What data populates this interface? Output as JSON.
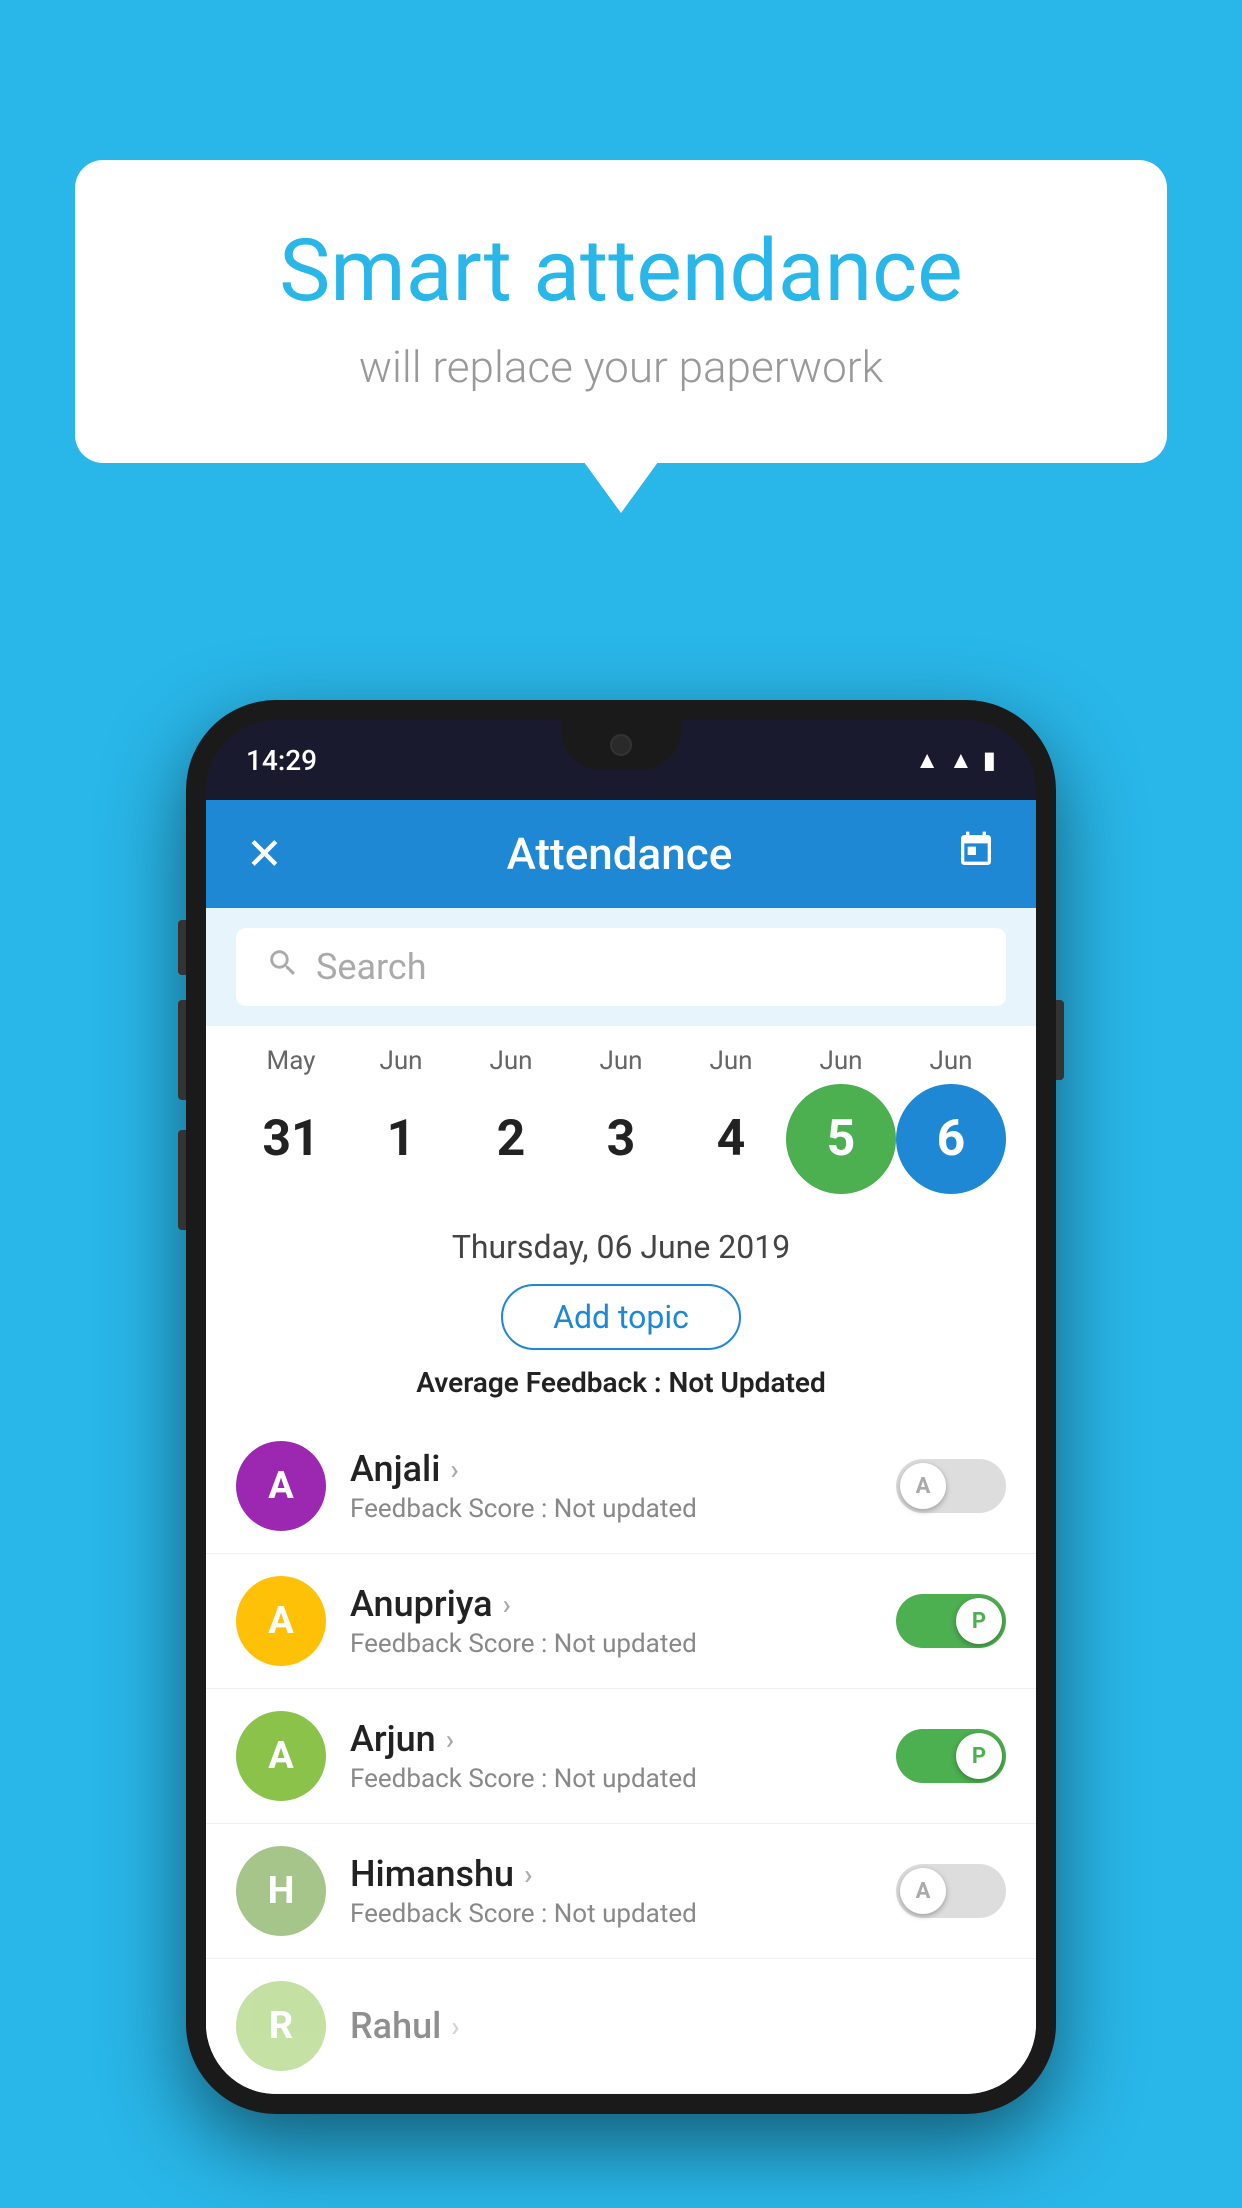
{
  "background_color": "#29b6e8",
  "speech_bubble": {
    "title": "Smart attendance",
    "subtitle": "will replace your paperwork"
  },
  "phone": {
    "status_bar": {
      "time": "14:29",
      "icons": [
        "wifi",
        "signal",
        "battery"
      ]
    },
    "header": {
      "title": "Attendance",
      "close_label": "✕",
      "calendar_icon": "📅"
    },
    "search": {
      "placeholder": "Search"
    },
    "calendar": {
      "months": [
        "May",
        "Jun",
        "Jun",
        "Jun",
        "Jun",
        "Jun",
        "Jun"
      ],
      "dates": [
        "31",
        "1",
        "2",
        "3",
        "4",
        "5",
        "6"
      ],
      "today_index": 5,
      "selected_index": 6
    },
    "date_display": "Thursday, 06 June 2019",
    "add_topic_label": "Add topic",
    "avg_feedback_label": "Average Feedback :",
    "avg_feedback_value": "Not Updated",
    "students": [
      {
        "name": "Anjali",
        "initial": "A",
        "avatar_color": "#9c27b0",
        "feedback": "Feedback Score : Not updated",
        "attendance": "A",
        "status": "off"
      },
      {
        "name": "Anupriya",
        "initial": "A",
        "avatar_color": "#ffc107",
        "feedback": "Feedback Score : Not updated",
        "attendance": "P",
        "status": "on"
      },
      {
        "name": "Arjun",
        "initial": "A",
        "avatar_color": "#8bc34a",
        "feedback": "Feedback Score : Not updated",
        "attendance": "P",
        "status": "on"
      },
      {
        "name": "Himanshu",
        "initial": "H",
        "avatar_color": "#a5c58a",
        "feedback": "Feedback Score : Not updated",
        "attendance": "A",
        "status": "off"
      }
    ]
  }
}
